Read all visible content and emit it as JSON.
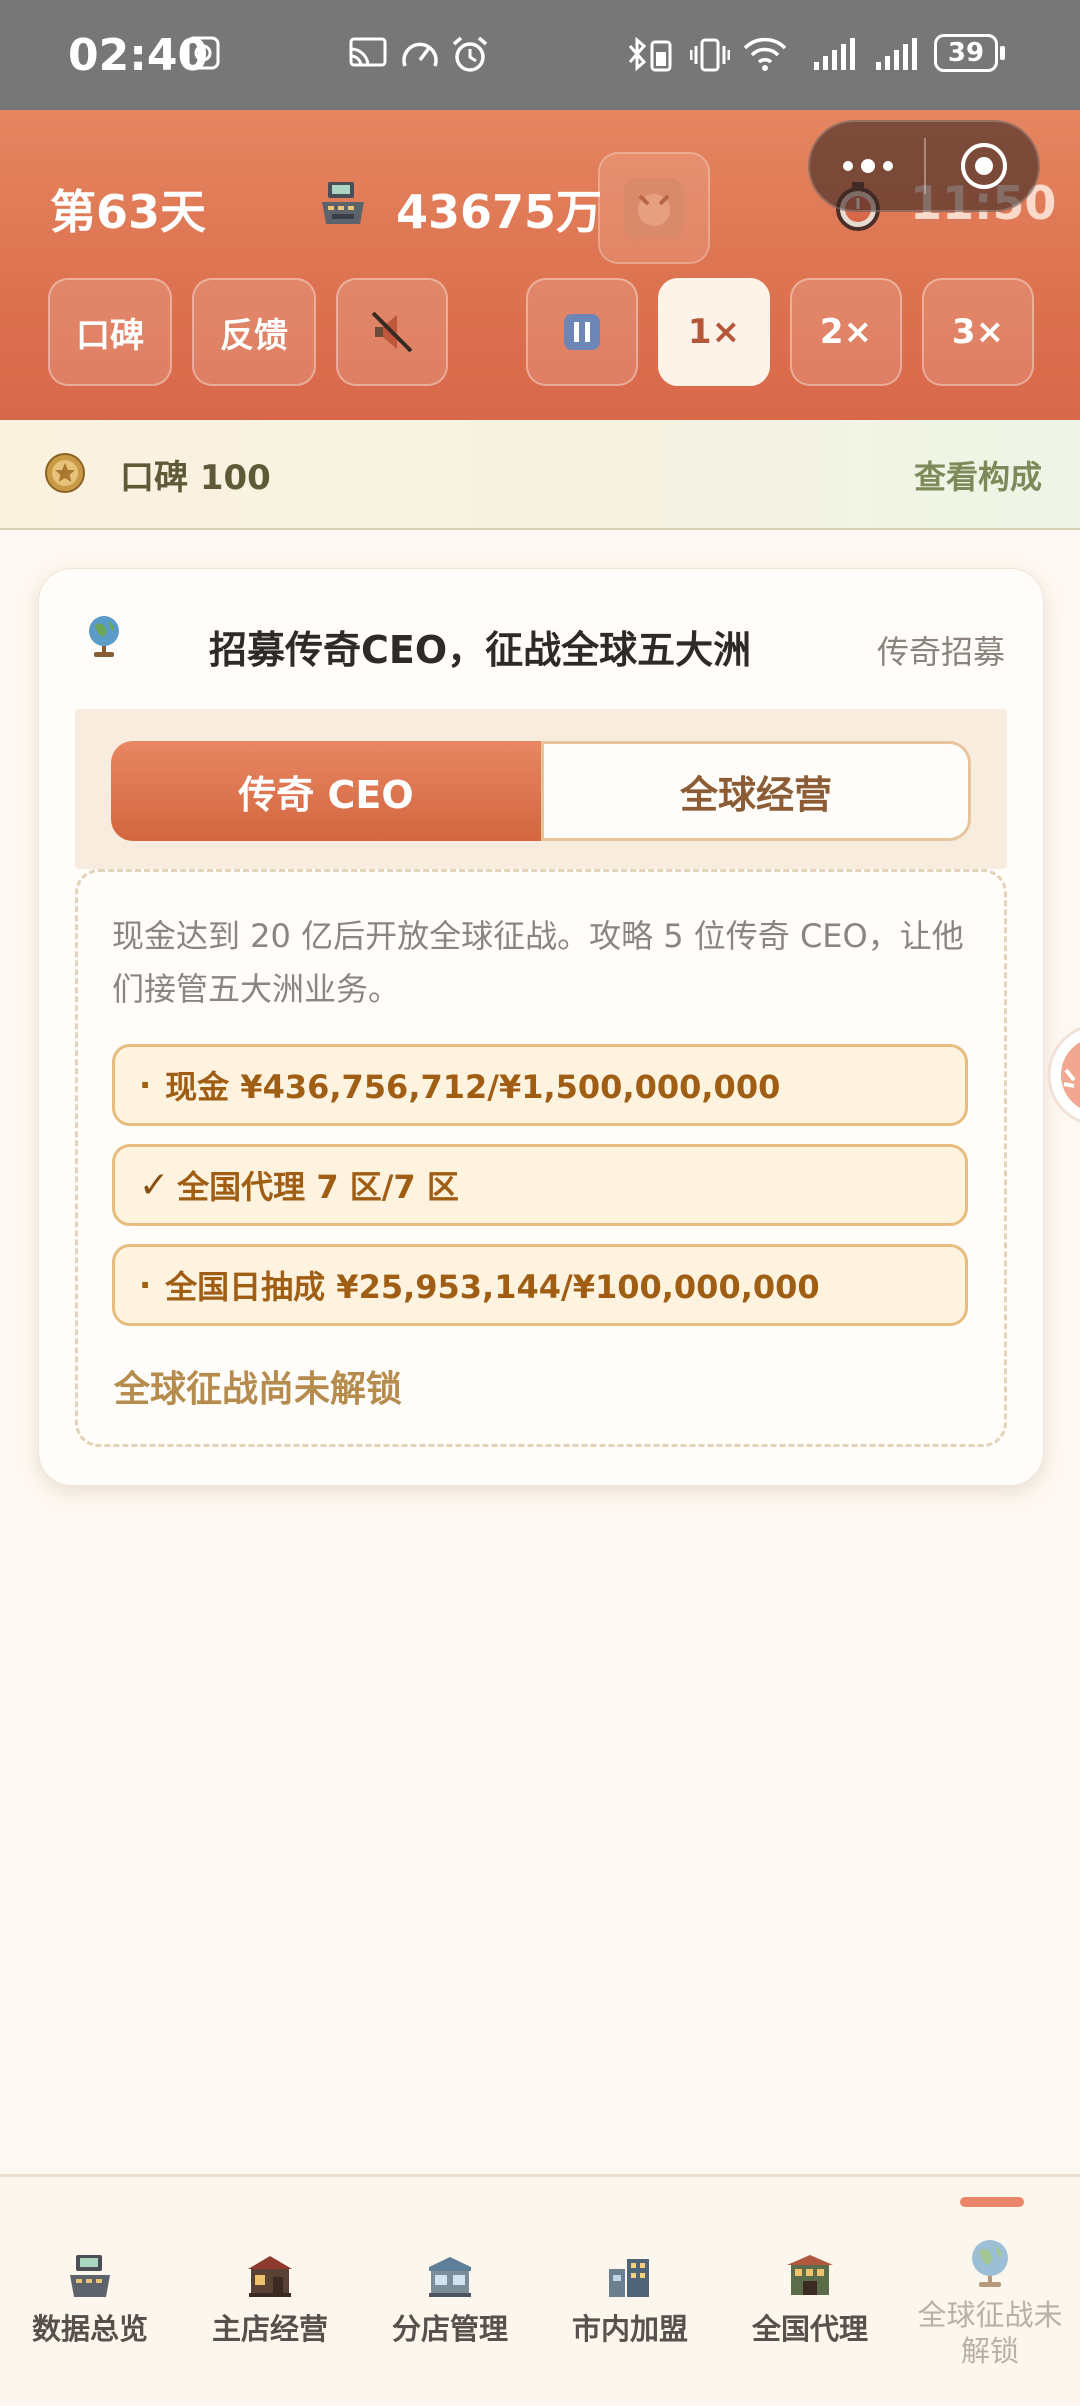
{
  "status_bar": {
    "time": "02:40",
    "battery": "39"
  },
  "header": {
    "day": "第63天",
    "money": "43675万",
    "clock": "11:50",
    "buttons": {
      "reputation": "口碑",
      "feedback": "反馈"
    },
    "speeds": [
      "1×",
      "2×",
      "3×"
    ],
    "active_speed": "1×"
  },
  "reputation_bar": {
    "label": "口碑 100",
    "link": "查看构成"
  },
  "card": {
    "title": "招募传奇CEO，征战全球五大洲",
    "badge": "传奇招募",
    "tabs": [
      {
        "label": "传奇 CEO",
        "active": true
      },
      {
        "label": "全球经营",
        "active": false
      }
    ],
    "description": "现金达到 20 亿后开放全球征战。攻略 5 位传奇 CEO，让他们接管五大洲业务。",
    "requirements": [
      {
        "mark": "·",
        "text": "现金 ¥436,756,712/¥1,500,000,000"
      },
      {
        "mark": "✓",
        "text": "全国代理 7 区/7 区"
      },
      {
        "mark": "·",
        "text": "全国日抽成 ¥25,953,144/¥100,000,000"
      }
    ],
    "locked_text": "全球征战尚未解锁"
  },
  "bottom_nav": [
    {
      "label": "数据总览",
      "icon": "cash-register-icon"
    },
    {
      "label": "主店经营",
      "icon": "main-store-icon"
    },
    {
      "label": "分店管理",
      "icon": "branch-store-icon"
    },
    {
      "label": "市内加盟",
      "icon": "city-franchise-icon"
    },
    {
      "label": "全国代理",
      "icon": "national-agency-icon"
    },
    {
      "label": "全球征战未解锁",
      "icon": "globe-icon",
      "active": true
    }
  ],
  "colors": {
    "header": "#dd7350",
    "accent": "#d2663f",
    "gold": "#a05d14"
  }
}
